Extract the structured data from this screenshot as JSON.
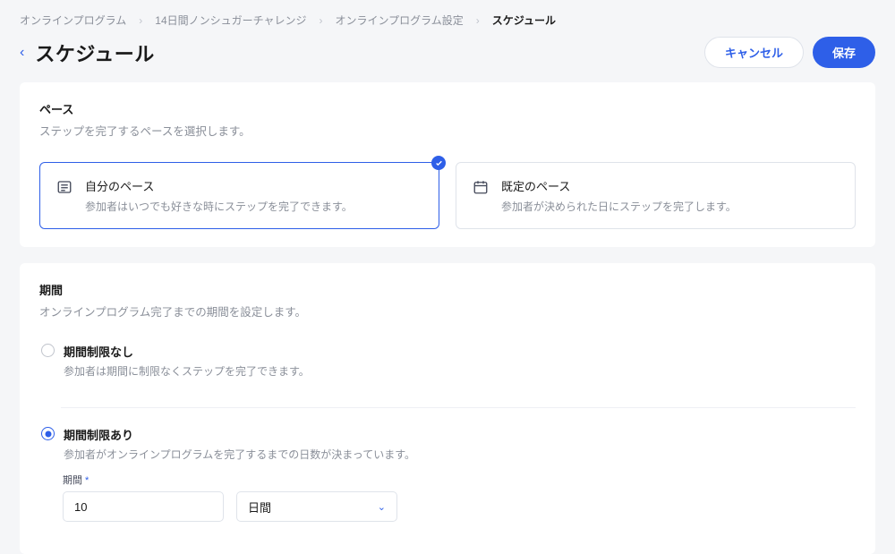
{
  "breadcrumb": {
    "items": [
      {
        "label": "オンラインプログラム"
      },
      {
        "label": "14日間ノンシュガーチャレンジ"
      },
      {
        "label": "オンラインプログラム設定"
      },
      {
        "label": "スケジュール"
      }
    ]
  },
  "header": {
    "title": "スケジュール",
    "cancel_label": "キャンセル",
    "save_label": "保存"
  },
  "pace_section": {
    "title": "ペース",
    "desc": "ステップを完了するペースを選択します。",
    "options": [
      {
        "title": "自分のペース",
        "desc": "参加者はいつでも好きな時にステップを完了できます。",
        "selected": true
      },
      {
        "title": "既定のペース",
        "desc": "参加者が決められた日にステップを完了します。",
        "selected": false
      }
    ]
  },
  "duration_section": {
    "title": "期間",
    "desc": "オンラインプログラム完了までの期間を設定します。",
    "options": [
      {
        "title": "期間制限なし",
        "desc": "参加者は期間に制限なくステップを完了できます。",
        "checked": false
      },
      {
        "title": "期間制限あり",
        "desc": "参加者がオンラインプログラムを完了するまでの日数が決まっています。",
        "checked": true
      }
    ],
    "period_field": {
      "label": "期間",
      "value": "10",
      "unit_selected": "日間"
    }
  }
}
